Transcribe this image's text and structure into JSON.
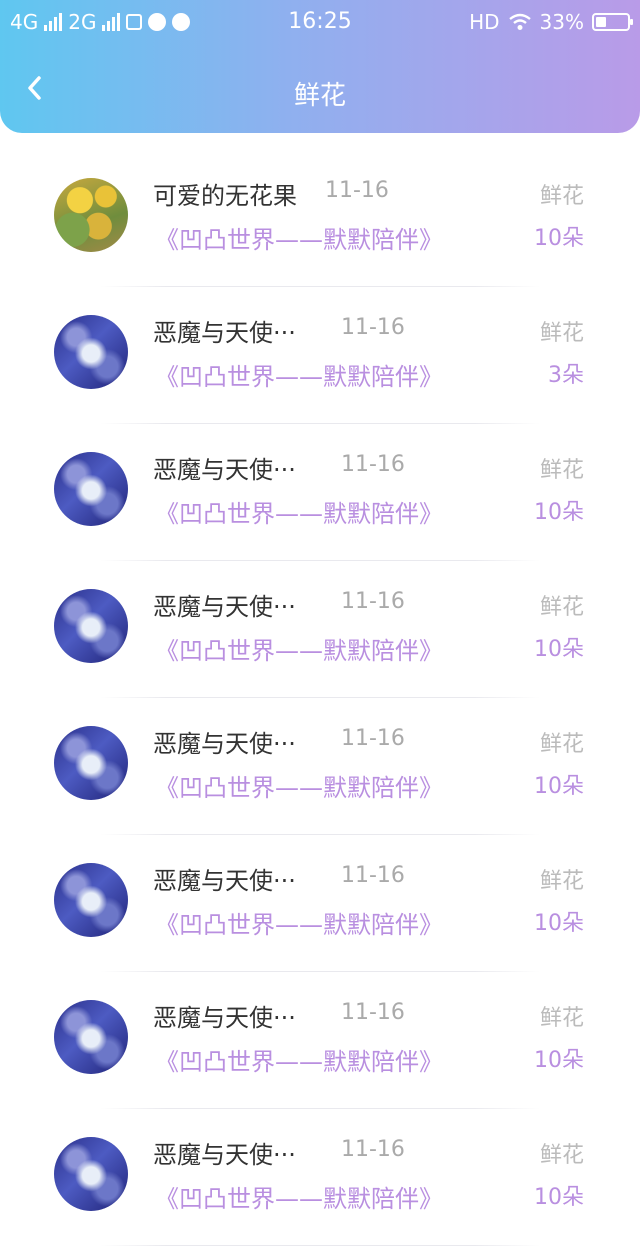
{
  "status_bar": {
    "net1": "4G",
    "net2": "2G",
    "time": "16:25",
    "hd": "HD",
    "battery_text": "33%",
    "battery_level": 0.33
  },
  "header": {
    "title": "鲜花"
  },
  "items": [
    {
      "name": "可爱的无花果",
      "date": "11-16",
      "subtitle": "《凹凸世界——默默陪伴》",
      "gift": "鲜花",
      "count": "10朵",
      "avatar": "sunflower-avatar"
    },
    {
      "name": "恶魔与天使···",
      "date": "11-16",
      "subtitle": "《凹凸世界——默默陪伴》",
      "gift": "鲜花",
      "count": "3朵",
      "avatar": "anime-avatar"
    },
    {
      "name": "恶魔与天使···",
      "date": "11-16",
      "subtitle": "《凹凸世界——默默陪伴》",
      "gift": "鲜花",
      "count": "10朵",
      "avatar": "anime-avatar"
    },
    {
      "name": "恶魔与天使···",
      "date": "11-16",
      "subtitle": "《凹凸世界——默默陪伴》",
      "gift": "鲜花",
      "count": "10朵",
      "avatar": "anime-avatar"
    },
    {
      "name": "恶魔与天使···",
      "date": "11-16",
      "subtitle": "《凹凸世界——默默陪伴》",
      "gift": "鲜花",
      "count": "10朵",
      "avatar": "anime-avatar"
    },
    {
      "name": "恶魔与天使···",
      "date": "11-16",
      "subtitle": "《凹凸世界——默默陪伴》",
      "gift": "鲜花",
      "count": "10朵",
      "avatar": "anime-avatar"
    },
    {
      "name": "恶魔与天使···",
      "date": "11-16",
      "subtitle": "《凹凸世界——默默陪伴》",
      "gift": "鲜花",
      "count": "10朵",
      "avatar": "anime-avatar"
    },
    {
      "name": "恶魔与天使···",
      "date": "11-16",
      "subtitle": "《凹凸世界——默默陪伴》",
      "gift": "鲜花",
      "count": "10朵",
      "avatar": "anime-avatar"
    }
  ],
  "colors": {
    "header_gradient_start": "#5fc7f0",
    "header_gradient_end": "#b99be8",
    "accent_purple": "#b98fe0"
  }
}
